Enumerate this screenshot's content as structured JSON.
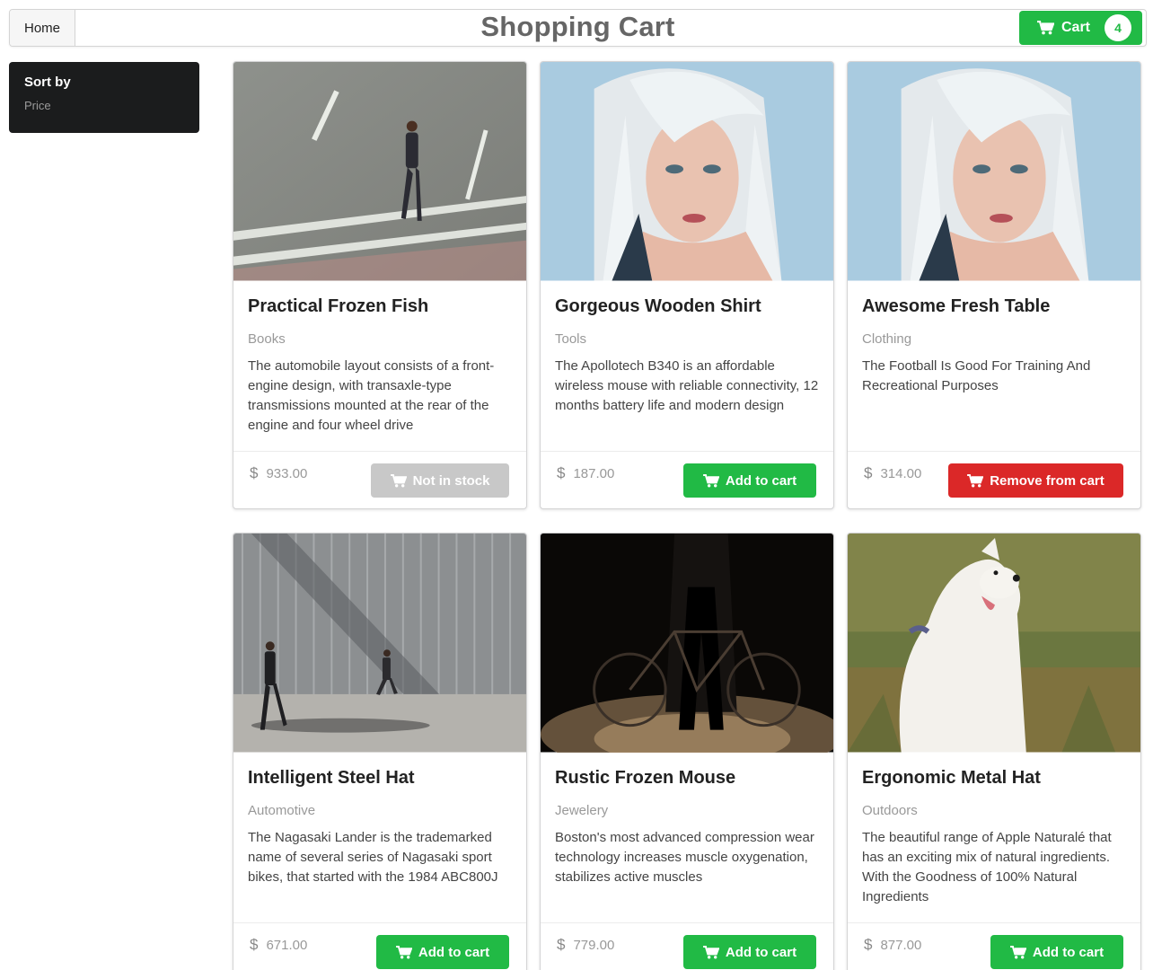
{
  "header": {
    "home_label": "Home",
    "title": "Shopping Cart",
    "cart_label": "Cart",
    "cart_count": "4"
  },
  "sidebar": {
    "title": "Sort by",
    "items": [
      "Price"
    ]
  },
  "currency_symbol": "$",
  "colors": {
    "green": "#21ba45",
    "red": "#db2828",
    "grey": "#c8c8c8",
    "dark": "#1b1c1d"
  },
  "products": [
    {
      "title": "Practical Frozen Fish",
      "category": "Books",
      "description": "The automobile layout consists of a front-engine design, with transaxle-type transmissions mounted at the rear of the engine and four wheel drive",
      "price": "933.00",
      "button": "Not in stock",
      "image": "man walking on road"
    },
    {
      "title": "Gorgeous Wooden Shirt",
      "category": "Tools",
      "description": "The Apollotech B340 is an affordable wireless mouse with reliable connectivity, 12 months battery life and modern design",
      "price": "187.00",
      "button": "Add to cart",
      "image": "woman portrait"
    },
    {
      "title": "Awesome Fresh Table",
      "category": "Clothing",
      "description": "The Football Is Good For Training And Recreational Purposes",
      "price": "314.00",
      "button": "Remove from cart",
      "image": "woman portrait"
    },
    {
      "title": "Intelligent Steel Hat",
      "category": "Automotive",
      "description": "The Nagasaki Lander is the trademarked name of several series of Nagasaki sport bikes, that started with the 1984 ABC800J",
      "price": "671.00",
      "button": "Add to cart",
      "image": "people walking by wall"
    },
    {
      "title": "Rustic Frozen Mouse",
      "category": "Jewelery",
      "description": "Boston's most advanced compression wear technology increases muscle oxygenation, stabilizes active muscles",
      "price": "779.00",
      "button": "Add to cart",
      "image": "bicycle in dark"
    },
    {
      "title": "Ergonomic Metal Hat",
      "category": "Outdoors",
      "description": "The beautiful range of Apple Naturalé that has an exciting mix of natural ingredients. With the Goodness of 100% Natural Ingredients",
      "price": "877.00",
      "button": "Add to cart",
      "image": "white dog"
    }
  ]
}
